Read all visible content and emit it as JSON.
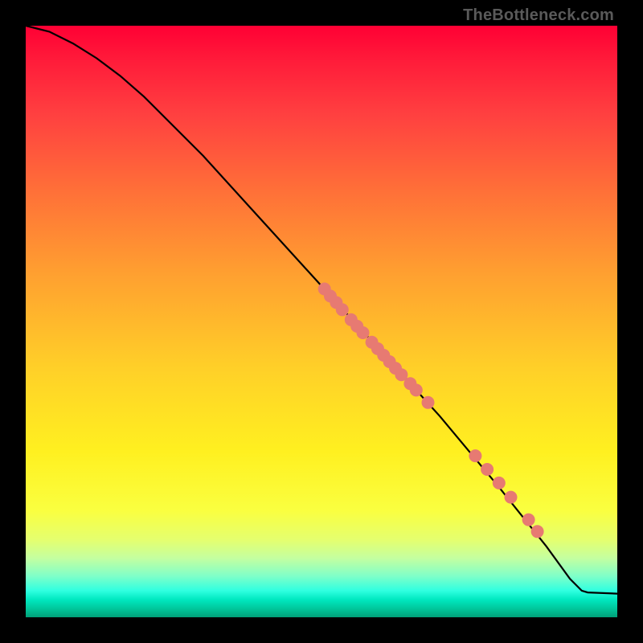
{
  "watermark": "TheBottleneck.com",
  "chart_data": {
    "type": "line",
    "title": "",
    "xlabel": "",
    "ylabel": "",
    "xlim": [
      0,
      100
    ],
    "ylim": [
      0,
      100
    ],
    "curve": [
      {
        "x": 0,
        "y": 100
      },
      {
        "x": 4,
        "y": 99
      },
      {
        "x": 8,
        "y": 97
      },
      {
        "x": 12,
        "y": 94.5
      },
      {
        "x": 16,
        "y": 91.5
      },
      {
        "x": 20,
        "y": 88
      },
      {
        "x": 30,
        "y": 78
      },
      {
        "x": 40,
        "y": 67
      },
      {
        "x": 50,
        "y": 56
      },
      {
        "x": 60,
        "y": 45
      },
      {
        "x": 70,
        "y": 34
      },
      {
        "x": 80,
        "y": 22
      },
      {
        "x": 88,
        "y": 12
      },
      {
        "x": 92,
        "y": 6.5
      },
      {
        "x": 94,
        "y": 4.5
      },
      {
        "x": 95,
        "y": 4.2
      },
      {
        "x": 100,
        "y": 4
      }
    ],
    "points": [
      {
        "x": 50.5,
        "y": 55.5
      },
      {
        "x": 51.5,
        "y": 54.3
      },
      {
        "x": 52.5,
        "y": 53.2
      },
      {
        "x": 53.5,
        "y": 52.0
      },
      {
        "x": 55.0,
        "y": 50.3
      },
      {
        "x": 56.0,
        "y": 49.2
      },
      {
        "x": 57.0,
        "y": 48.1
      },
      {
        "x": 58.5,
        "y": 46.5
      },
      {
        "x": 59.5,
        "y": 45.4
      },
      {
        "x": 60.5,
        "y": 44.3
      },
      {
        "x": 61.5,
        "y": 43.2
      },
      {
        "x": 62.5,
        "y": 42.1
      },
      {
        "x": 63.5,
        "y": 41.0
      },
      {
        "x": 65.0,
        "y": 39.5
      },
      {
        "x": 66.0,
        "y": 38.4
      },
      {
        "x": 68.0,
        "y": 36.3
      },
      {
        "x": 76.0,
        "y": 27.3
      },
      {
        "x": 78.0,
        "y": 25.0
      },
      {
        "x": 80.0,
        "y": 22.7
      },
      {
        "x": 82.0,
        "y": 20.3
      },
      {
        "x": 85.0,
        "y": 16.5
      },
      {
        "x": 86.5,
        "y": 14.5
      }
    ],
    "point_color": "#e77a72",
    "line_color": "#000000",
    "point_radius": 8
  }
}
